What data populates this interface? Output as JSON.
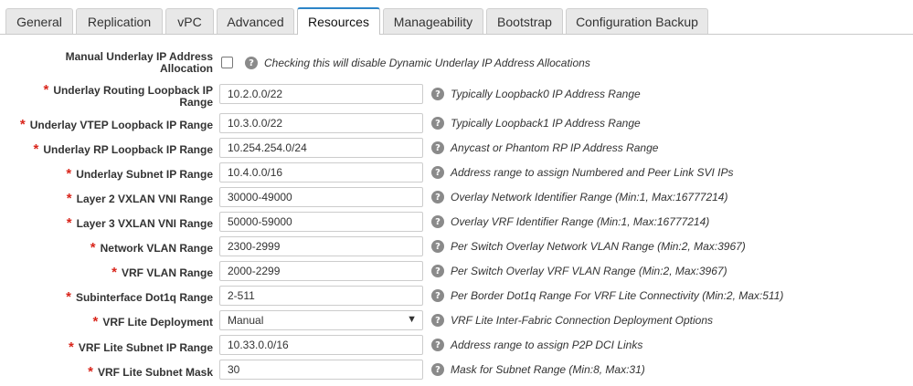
{
  "tabs": [
    {
      "label": "General",
      "active": false
    },
    {
      "label": "Replication",
      "active": false
    },
    {
      "label": "vPC",
      "active": false
    },
    {
      "label": "Advanced",
      "active": false
    },
    {
      "label": "Resources",
      "active": true
    },
    {
      "label": "Manageability",
      "active": false
    },
    {
      "label": "Bootstrap",
      "active": false
    },
    {
      "label": "Configuration Backup",
      "active": false
    }
  ],
  "required_marker": "*",
  "help_icon_glyph": "?",
  "fields": [
    {
      "label_line1": "Manual Underlay IP Address",
      "label_line2": "Allocation",
      "required": false,
      "type": "checkbox",
      "checked": false,
      "hint": "Checking this will disable Dynamic Underlay IP Address Allocations"
    },
    {
      "label_line1": "Underlay Routing Loopback IP",
      "label_line2": "Range",
      "required": true,
      "type": "text",
      "value": "10.2.0.0/22",
      "hint": "Typically Loopback0 IP Address Range"
    },
    {
      "label_line1": "Underlay VTEP Loopback IP Range",
      "label_line2": "",
      "required": true,
      "type": "text",
      "value": "10.3.0.0/22",
      "hint": "Typically Loopback1 IP Address Range"
    },
    {
      "label_line1": "Underlay RP Loopback IP Range",
      "label_line2": "",
      "required": true,
      "type": "text",
      "value": "10.254.254.0/24",
      "hint": "Anycast or Phantom RP IP Address Range"
    },
    {
      "label_line1": "Underlay Subnet IP Range",
      "label_line2": "",
      "required": true,
      "type": "text",
      "value": "10.4.0.0/16",
      "hint": "Address range to assign Numbered and Peer Link SVI IPs"
    },
    {
      "label_line1": "Layer 2 VXLAN VNI Range",
      "label_line2": "",
      "required": true,
      "type": "text",
      "value": "30000-49000",
      "hint": "Overlay Network Identifier Range (Min:1, Max:16777214)"
    },
    {
      "label_line1": "Layer 3 VXLAN VNI Range",
      "label_line2": "",
      "required": true,
      "type": "text",
      "value": "50000-59000",
      "hint": "Overlay VRF Identifier Range (Min:1, Max:16777214)"
    },
    {
      "label_line1": "Network VLAN Range",
      "label_line2": "",
      "required": true,
      "type": "text",
      "value": "2300-2999",
      "hint": "Per Switch Overlay Network VLAN Range (Min:2, Max:3967)"
    },
    {
      "label_line1": "VRF VLAN Range",
      "label_line2": "",
      "required": true,
      "type": "text",
      "value": "2000-2299",
      "hint": "Per Switch Overlay VRF VLAN Range (Min:2, Max:3967)"
    },
    {
      "label_line1": "Subinterface Dot1q Range",
      "label_line2": "",
      "required": true,
      "type": "text",
      "value": "2-511",
      "hint": "Per Border Dot1q Range For VRF Lite Connectivity (Min:2, Max:511)"
    },
    {
      "label_line1": "VRF Lite Deployment",
      "label_line2": "",
      "required": true,
      "type": "select",
      "value": "Manual",
      "caret": "▼",
      "hint": "VRF Lite Inter-Fabric Connection Deployment Options"
    },
    {
      "label_line1": "VRF Lite Subnet IP Range",
      "label_line2": "",
      "required": true,
      "type": "text",
      "value": "10.33.0.0/16",
      "hint": "Address range to assign P2P DCI Links"
    },
    {
      "label_line1": "VRF Lite Subnet Mask",
      "label_line2": "",
      "required": true,
      "type": "text",
      "value": "30",
      "hint": "Mask for Subnet Range (Min:8, Max:31)"
    }
  ]
}
